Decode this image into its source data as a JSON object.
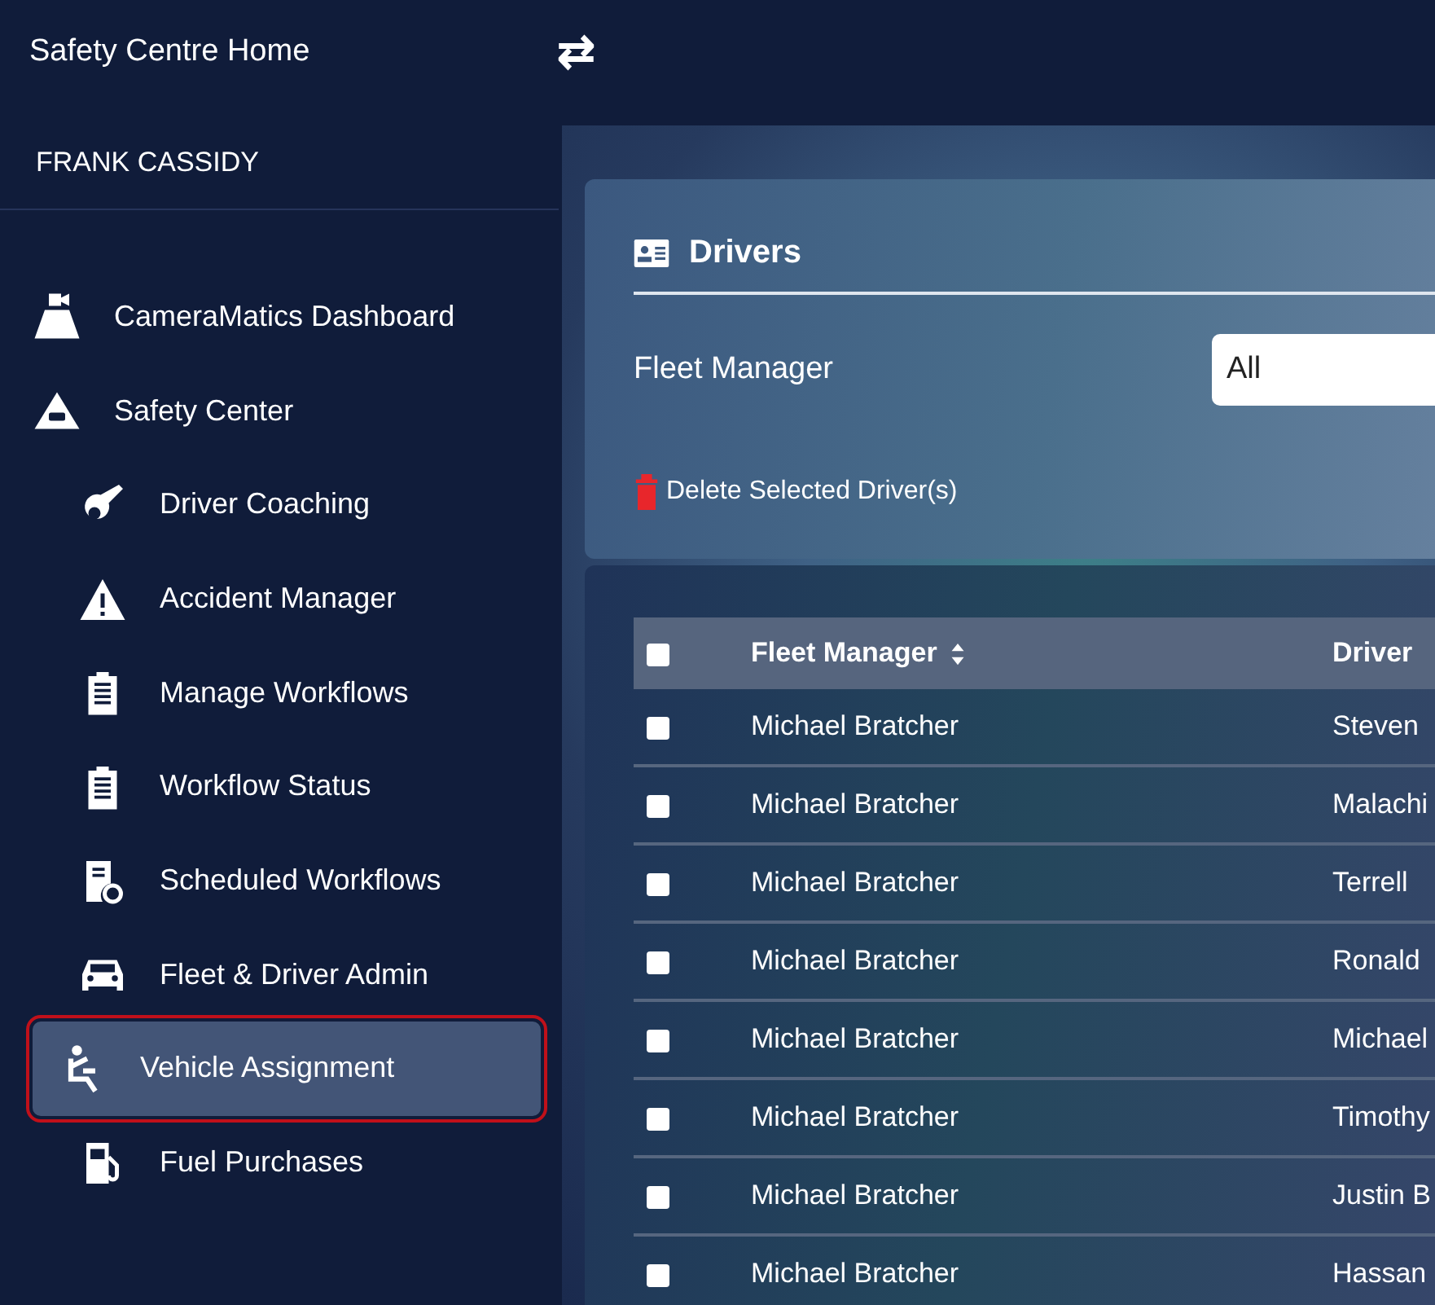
{
  "top_bar": {
    "title": "Safety Centre Home",
    "toggle_icon": "⇄"
  },
  "sidebar": {
    "user": "FRANK CASSIDY",
    "items": [
      {
        "label": "CameraMatics Dashboard",
        "selected": false
      },
      {
        "label": "Safety Center",
        "selected": false,
        "children": [
          {
            "label": "Driver Coaching",
            "selected": false
          },
          {
            "label": "Accident Manager",
            "selected": false
          },
          {
            "label": "Manage Workflows",
            "selected": false
          },
          {
            "label": "Workflow Status",
            "selected": false
          },
          {
            "label": "Scheduled Workflows",
            "selected": false
          },
          {
            "label": "Fleet & Driver Admin",
            "selected": false
          },
          {
            "label": "Vehicle Assignment",
            "selected": true
          },
          {
            "label": "Fuel Purchases",
            "selected": false
          }
        ]
      }
    ]
  },
  "drivers_panel": {
    "title": "Drivers",
    "filter": {
      "label": "Fleet Manager",
      "value": "All"
    },
    "delete_button": "Delete Selected Driver(s)"
  },
  "table": {
    "all_checked": false,
    "columns": [
      "Fleet Manager",
      "Driver"
    ],
    "sortable": [
      true,
      false
    ],
    "rows": [
      {
        "checked": false,
        "cells": [
          "Michael Bratcher",
          "Steven"
        ]
      },
      {
        "checked": false,
        "cells": [
          "Michael Bratcher",
          "Malachi"
        ]
      },
      {
        "checked": false,
        "cells": [
          "Michael Bratcher",
          "Terrell"
        ]
      },
      {
        "checked": false,
        "cells": [
          "Michael Bratcher",
          "Ronald"
        ]
      },
      {
        "checked": false,
        "cells": [
          "Michael Bratcher",
          "Michael"
        ]
      },
      {
        "checked": false,
        "cells": [
          "Michael Bratcher",
          "Timothy"
        ]
      },
      {
        "checked": false,
        "cells": [
          "Michael Bratcher",
          "Justin B"
        ]
      },
      {
        "checked": false,
        "cells": [
          "Michael Bratcher",
          "Hassan"
        ]
      }
    ]
  }
}
